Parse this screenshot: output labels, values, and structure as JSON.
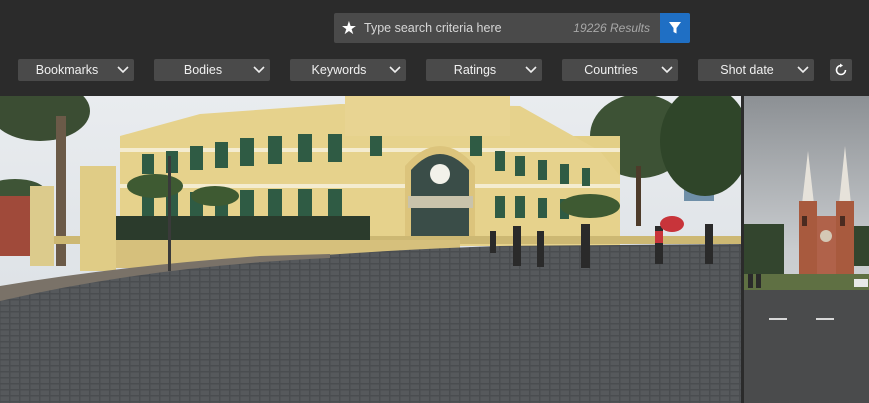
{
  "search": {
    "placeholder": "Type search criteria here",
    "results_count": "19226 Results",
    "star_icon": "star-icon",
    "filter_icon": "funnel-icon",
    "filter_color": "#1f6fc4"
  },
  "filters": [
    {
      "label": "Bookmarks"
    },
    {
      "label": "Bodies"
    },
    {
      "label": "Keywords"
    },
    {
      "label": "Ratings"
    },
    {
      "label": "Countries"
    },
    {
      "label": "Shot date"
    }
  ],
  "refresh_icon": "refresh-icon",
  "photos": [
    {
      "subject": "Saigon Central Post Office panorama"
    },
    {
      "subject": "Notre-Dame Cathedral Basilica of Saigon"
    }
  ]
}
